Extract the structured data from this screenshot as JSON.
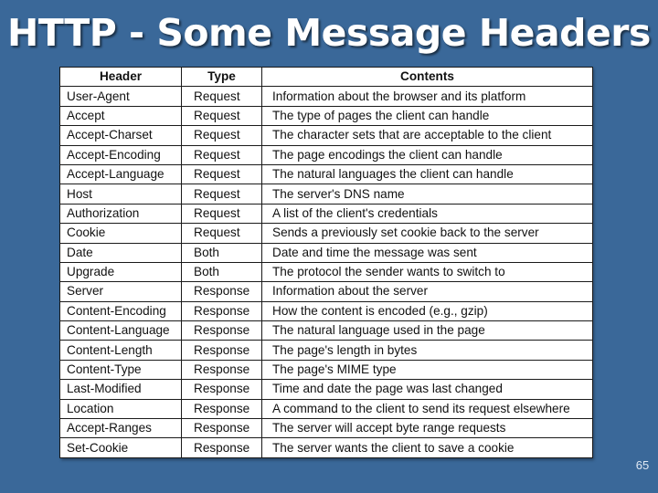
{
  "slide": {
    "title": "HTTP - Some Message Headers",
    "page_number": "65",
    "colors": {
      "background": "#3a6899",
      "title_text": "#ffffff",
      "table_background": "#ffffff",
      "table_border": "#1a1a1a"
    }
  },
  "table": {
    "columns": [
      "Header",
      "Type",
      "Contents"
    ],
    "rows": [
      {
        "header": "User-Agent",
        "type": "Request",
        "contents": "Information about the browser and its platform"
      },
      {
        "header": "Accept",
        "type": "Request",
        "contents": "The type of pages the client can handle"
      },
      {
        "header": "Accept-Charset",
        "type": "Request",
        "contents": "The character sets that are acceptable to the client"
      },
      {
        "header": "Accept-Encoding",
        "type": "Request",
        "contents": "The page encodings the client can handle"
      },
      {
        "header": "Accept-Language",
        "type": "Request",
        "contents": "The natural languages the client can handle"
      },
      {
        "header": "Host",
        "type": "Request",
        "contents": "The server's DNS name"
      },
      {
        "header": "Authorization",
        "type": "Request",
        "contents": "A list of the client's credentials"
      },
      {
        "header": "Cookie",
        "type": "Request",
        "contents": "Sends a previously set cookie back to the server"
      },
      {
        "header": "Date",
        "type": "Both",
        "contents": "Date and time the message was sent"
      },
      {
        "header": "Upgrade",
        "type": "Both",
        "contents": "The protocol the sender wants to switch to"
      },
      {
        "header": "Server",
        "type": "Response",
        "contents": "Information about the server"
      },
      {
        "header": "Content-Encoding",
        "type": "Response",
        "contents": "How the content is encoded (e.g., gzip)"
      },
      {
        "header": "Content-Language",
        "type": "Response",
        "contents": "The natural language used in the page"
      },
      {
        "header": "Content-Length",
        "type": "Response",
        "contents": "The page's length in bytes"
      },
      {
        "header": "Content-Type",
        "type": "Response",
        "contents": "The page's MIME type"
      },
      {
        "header": "Last-Modified",
        "type": "Response",
        "contents": "Time and date the page was last changed"
      },
      {
        "header": "Location",
        "type": "Response",
        "contents": "A command to the client to send its request elsewhere"
      },
      {
        "header": "Accept-Ranges",
        "type": "Response",
        "contents": "The server will accept byte range requests"
      },
      {
        "header": "Set-Cookie",
        "type": "Response",
        "contents": "The server wants the client to save a cookie"
      }
    ]
  }
}
